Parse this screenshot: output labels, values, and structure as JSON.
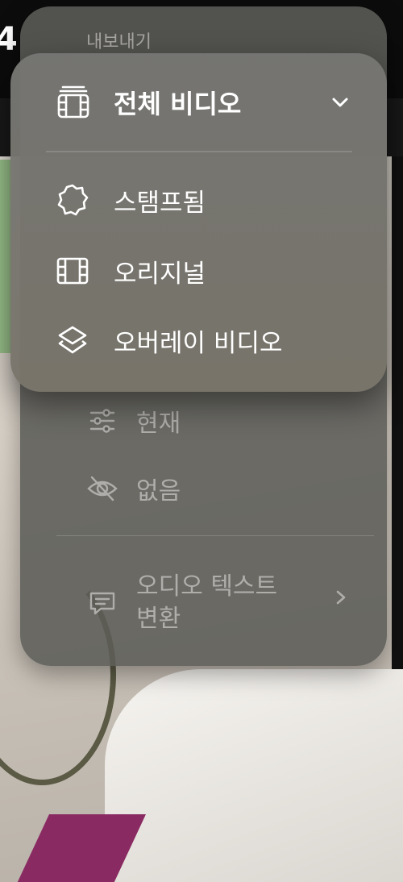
{
  "status": {
    "top_left_digit": "4"
  },
  "back_menu": {
    "header_label": "내보내기",
    "items": [
      {
        "label": "현재",
        "icon": "sliders-icon"
      },
      {
        "label": "없음",
        "icon": "eye-slash-icon"
      },
      {
        "label": "오디오 텍스트 변환",
        "icon": "chat-bubble-icon",
        "has_submenu": true
      }
    ]
  },
  "menu": {
    "selected": "전체 비디오",
    "header_icon": "stacked-film-icon",
    "options": [
      {
        "label": "스탬프됨",
        "icon": "badge-icon"
      },
      {
        "label": "오리지널",
        "icon": "film-icon"
      },
      {
        "label": "오버레이 비디오",
        "icon": "layers-icon"
      }
    ]
  }
}
